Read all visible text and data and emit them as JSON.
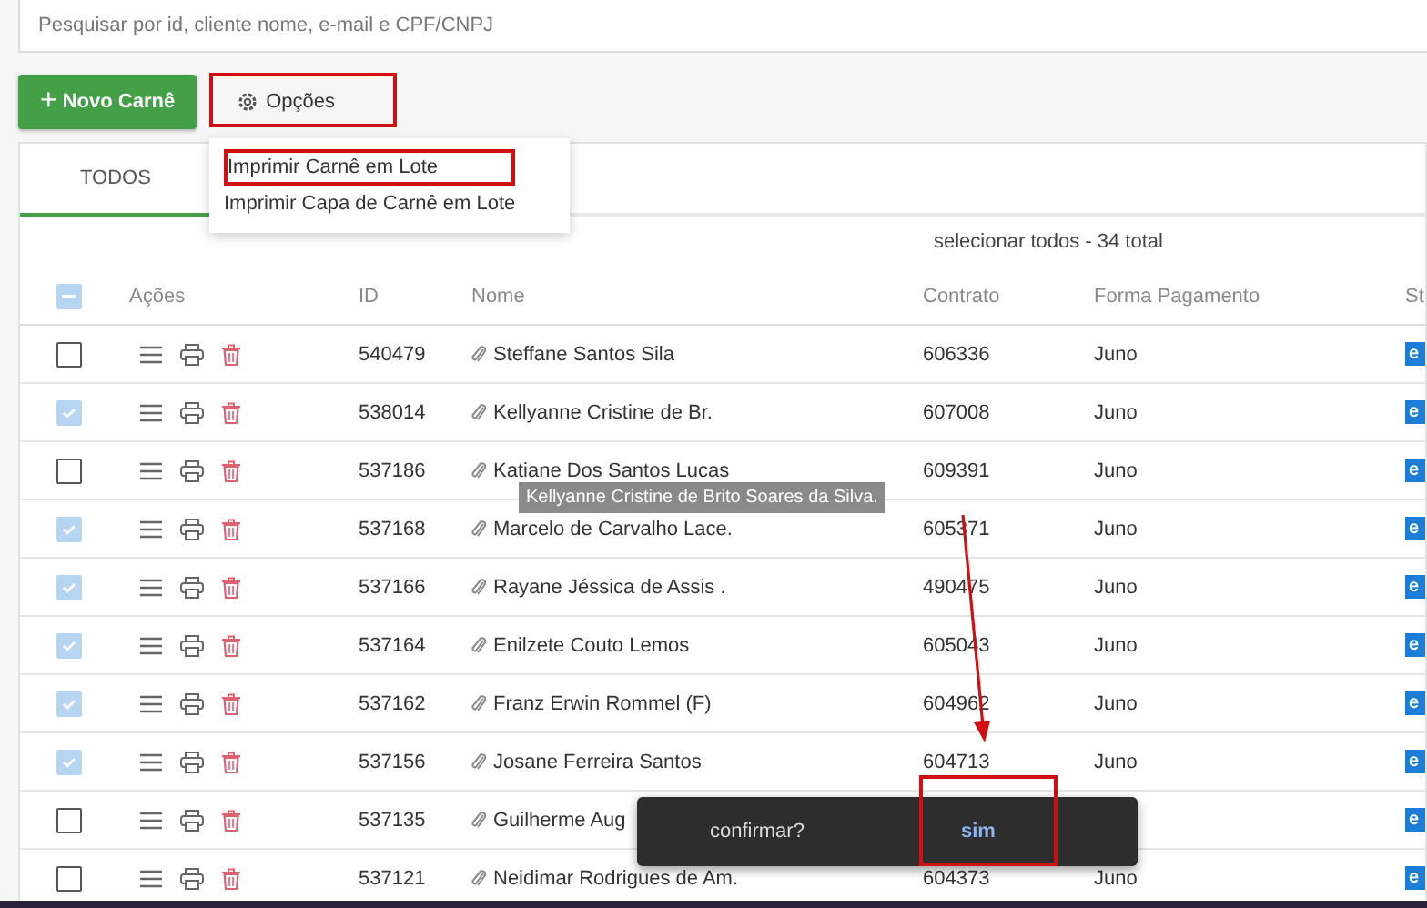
{
  "search": {
    "placeholder": "Pesquisar por id, cliente nome, e-mail e CPF/CNPJ"
  },
  "toolbar": {
    "new_button": {
      "icon": "+",
      "label": "Novo Carnê"
    },
    "options_button": {
      "label": "Opções"
    }
  },
  "options_menu": {
    "items": [
      {
        "label": "Imprimir Carnê em Lote",
        "selected": true
      },
      {
        "label": "Imprimir Capa de Carnê em Lote",
        "selected": false
      }
    ]
  },
  "tabs": [
    {
      "label": "TODOS",
      "selected": true
    }
  ],
  "select_all": "selecionar todos - 34 total",
  "table": {
    "header_checkbox": {
      "indeterminate": true
    },
    "columns": [
      "Ações",
      "ID",
      "Nome",
      "Contrato",
      "Forma Pagamento",
      "St"
    ],
    "rows": [
      {
        "checked": false,
        "id": "540479",
        "name": "Steffane Santos Sila",
        "contract": "606336",
        "payment": "Juno",
        "status": "e"
      },
      {
        "checked": true,
        "id": "538014",
        "name": "Kellyanne Cristine de Br.",
        "contract": "607008",
        "payment": "Juno",
        "status": "e"
      },
      {
        "checked": false,
        "id": "537186",
        "name": "Katiane Dos Santos Lucas",
        "contract": "609391",
        "payment": "Juno",
        "status": "e"
      },
      {
        "checked": true,
        "id": "537168",
        "name": "Marcelo de Carvalho Lace.",
        "contract": "605371",
        "payment": "Juno",
        "status": "e"
      },
      {
        "checked": true,
        "id": "537166",
        "name": "Rayane Jéssica de Assis .",
        "contract": "490475",
        "payment": "Juno",
        "status": "e"
      },
      {
        "checked": true,
        "id": "537164",
        "name": "Enilzete Couto Lemos",
        "contract": "605043",
        "payment": "Juno",
        "status": "e"
      },
      {
        "checked": true,
        "id": "537162",
        "name": "Franz Erwin Rommel (F)",
        "contract": "604962",
        "payment": "Juno",
        "status": "e"
      },
      {
        "checked": true,
        "id": "537156",
        "name": "Josane Ferreira Santos",
        "contract": "604713",
        "payment": "Juno",
        "status": "e"
      },
      {
        "checked": false,
        "id": "537135",
        "name": "Guilherme Aug",
        "status": "e"
      },
      {
        "checked": false,
        "id": "537121",
        "name": "Neidimar Rodrigues de Am.",
        "contract": "604373",
        "payment": "Juno",
        "status": "e"
      }
    ]
  },
  "tooltip": {
    "text": "Kellyanne Cristine de Brito Soares da Silva."
  },
  "snackbar": {
    "message": "confirmar?",
    "action": "sim"
  }
}
